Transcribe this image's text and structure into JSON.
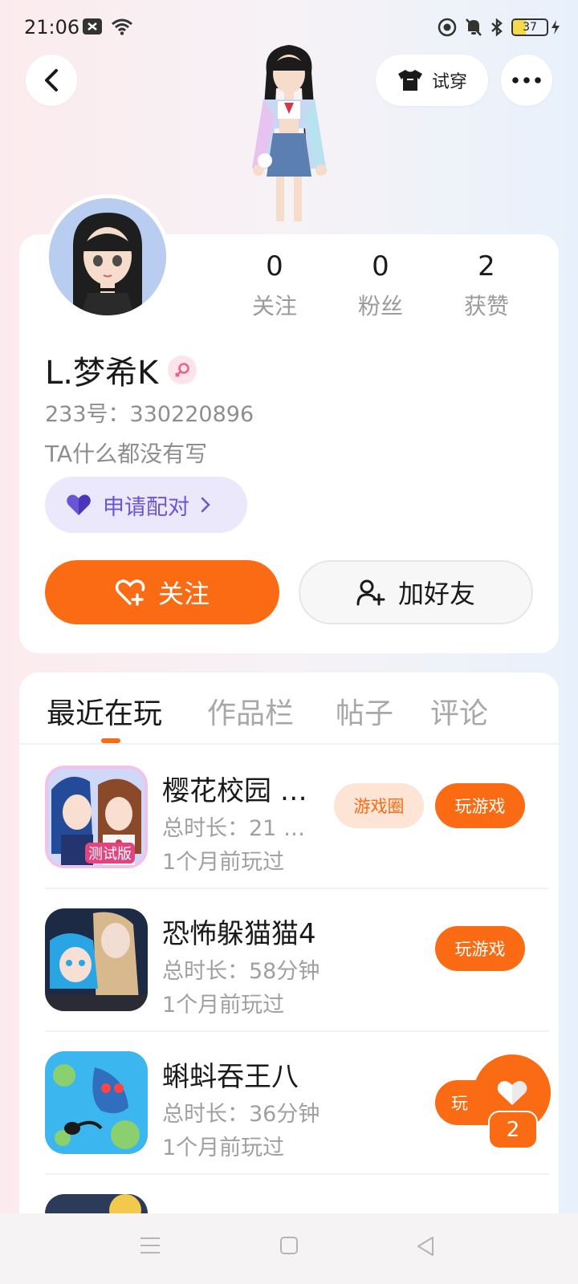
{
  "status_bar": {
    "time": "21:06",
    "battery_level": "37",
    "battery_fraction": 0.37
  },
  "header": {
    "try_on_label": "试穿"
  },
  "profile": {
    "stats": [
      {
        "value": "0",
        "label": "关注"
      },
      {
        "value": "0",
        "label": "粉丝"
      },
      {
        "value": "2",
        "label": "获赞"
      }
    ],
    "username": "L.梦希K",
    "gender_icon": "female-icon",
    "user_id": "233号：330220896",
    "bio": "TA什么都没有写",
    "pair_button_label": "申请配对",
    "follow_button_label": "关注",
    "add_friend_button_label": "加好友"
  },
  "tabs": [
    {
      "label": "最近在玩",
      "active": true
    },
    {
      "label": "作品栏",
      "active": false
    },
    {
      "label": "帖子",
      "active": false
    },
    {
      "label": "评论",
      "active": false
    }
  ],
  "games": [
    {
      "title": "樱花校园 …",
      "duration": "总时长：21 …",
      "last_played": "1个月前玩过",
      "circle_label": "游戏圈",
      "play_label": "玩游戏",
      "icon_badge": "测试版"
    },
    {
      "title": "恐怖躲猫猫4",
      "duration": "总时长：58分钟",
      "last_played": "1个月前玩过",
      "play_label": "玩游戏"
    },
    {
      "title": "蝌蚪吞王八",
      "duration": "总时长：36分钟",
      "last_played": "1个月前玩过",
      "play_label": "玩"
    }
  ],
  "like_fab": {
    "count": "2"
  },
  "colors": {
    "accent": "#fb6b14",
    "pair_purple": "#6a55d9",
    "muted": "#9b9b9b"
  }
}
